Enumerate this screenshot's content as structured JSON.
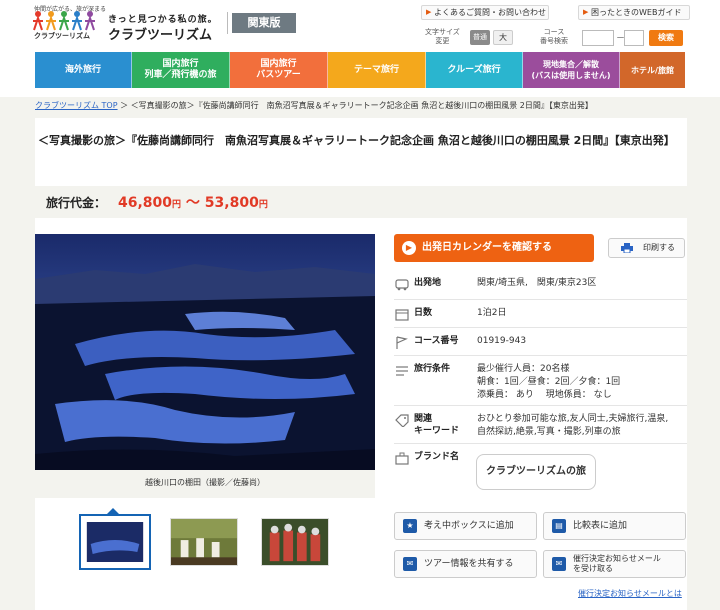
{
  "header": {
    "tagline": "仲間が広がる、旅が深まる",
    "logo_text": "クラブツーリズム",
    "slogan": "きっと見つかる私の旅。",
    "brand": "クラブツーリズム",
    "region": "関東版",
    "faq_link": "よくあるご質問・お問い合わせ",
    "help_link": "困ったときのWEBガイド",
    "font_size_label": "文字サイズ\n変更",
    "font_normal": "普通",
    "font_large": "大",
    "course_label": "コース\n番号検索",
    "course_dash": "－",
    "course_button": "検索"
  },
  "nav": [
    {
      "label": "海外旅行",
      "color": "#2a8fd0"
    },
    {
      "label": "国内旅行\n列車／飛行機の旅",
      "color": "#2fae5e"
    },
    {
      "label": "国内旅行\nバスツアー",
      "color": "#f26f3c"
    },
    {
      "label": "テーマ旅行",
      "color": "#f4a81c"
    },
    {
      "label": "クルーズ旅行",
      "color": "#2ab5cf"
    },
    {
      "label": "現地集合／解散\n(バスは使用しません)",
      "color": "#9b4d9c"
    },
    {
      "label": "ホテル/旅館",
      "color": "#d2672a"
    }
  ],
  "breadcrumb": {
    "home": "クラブツーリズム TOP",
    "sep": " ＞ ",
    "current": "＜写真撮影の旅＞『佐藤尚講師同行　南魚沼写真展＆ギャラリートーク記念企画 魚沼と越後川口の棚田風景 2日間』【東京出発】"
  },
  "tour": {
    "title": "＜写真撮影の旅＞『佐藤尚講師同行　南魚沼写真展＆ギャラリートーク記念企画 魚沼と越後川口の棚田風景 2日間』【東京出発】",
    "price_label": "旅行代金：",
    "price_min": "46,800",
    "price_tilde": " ～ ",
    "price_max": "53,800",
    "yen": "円",
    "photo_caption": "越後川口の棚田（撮影／佐藤尚）",
    "calendar_button": "出発日カレンダーを確認する",
    "print_button": "印刷する"
  },
  "info": {
    "departure_label": "出発地",
    "departure_value": "関東/埼玉県,　関東/東京23区",
    "days_label": "日数",
    "days_value": "1泊2日",
    "course_label": "コース番号",
    "course_value": "01919-943",
    "conditions_label": "旅行条件",
    "conditions_line1": "最少催行人員：20名様",
    "conditions_line2": "朝食：1回／昼食：2回／夕食：1回",
    "conditions_line3": "添乗員： あり　 現地係員： なし",
    "keywords_label1": "関連",
    "keywords_label2": "キーワード",
    "keywords_line1": "おひとり参加可能な旅,友人同士,夫婦旅行,温泉,",
    "keywords_line2": "自然探訪,絶景,写真・撮影,列車の旅",
    "brand_label": "ブランド名",
    "brand_value": "クラブツーリズムの旅"
  },
  "actions": {
    "favorite": "考え中ボックスに追加",
    "compare": "比較表に追加",
    "share": "ツアー情報を共有する",
    "notify_line1": "催行決定お知らせメール",
    "notify_line2": "を受け取る",
    "notify_link": "催行決定お知らせメールとは"
  },
  "colors": {
    "accent": "#ee6212",
    "price": "#e13a26",
    "link": "#2a64c5"
  }
}
